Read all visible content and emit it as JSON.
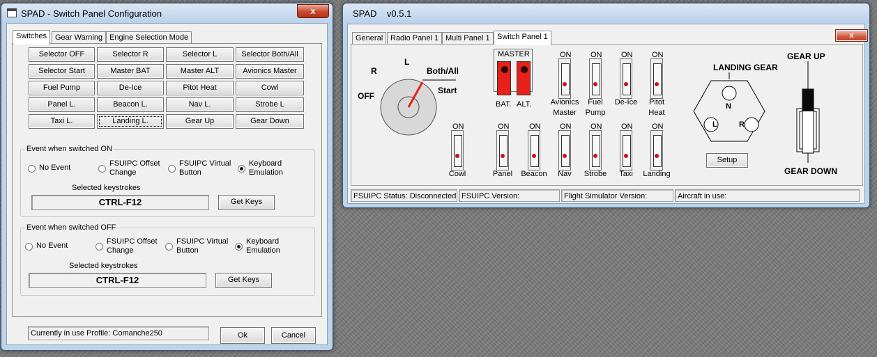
{
  "left_window": {
    "title": "SPAD - Switch Panel Configuration",
    "close_label": "x",
    "tabs": [
      {
        "label": "Switches",
        "active": true
      },
      {
        "label": "Gear Warning",
        "active": false
      },
      {
        "label": "Engine Selection Mode",
        "active": false
      }
    ],
    "switch_buttons": [
      "Selector OFF",
      "Selector R",
      "Selector L",
      "Selector Both/All",
      "Selector Start",
      "Master BAT",
      "Master ALT",
      "Avionics Master",
      "Fuel Pump",
      "De-Ice",
      "Pitot Heat",
      "Cowl",
      "Panel L.",
      "Beacon L.",
      "Nav L.",
      "Strobe L",
      "Taxi L.",
      "Landing L.",
      "Gear Up",
      "Gear Down"
    ],
    "selected_button": "Landing L.",
    "event_on": {
      "label": "Event when switched ON",
      "options": [
        {
          "label": "No Event",
          "checked": false
        },
        {
          "label": "FSUIPC Offset\nChange",
          "checked": false
        },
        {
          "label": "FSUIPC Virtual\nButton",
          "checked": false
        },
        {
          "label": "Keyboard\nEmulation",
          "checked": true
        }
      ],
      "keystrokes_label": "Selected keystrokes",
      "keystrokes_value": "CTRL-F12",
      "get_keys_label": "Get Keys"
    },
    "event_off": {
      "label": "Event when switched OFF",
      "options": [
        {
          "label": "No Event",
          "checked": false
        },
        {
          "label": "FSUIPC Offset\nChange",
          "checked": false
        },
        {
          "label": "FSUIPC Virtual\nButton",
          "checked": false
        },
        {
          "label": "Keyboard\nEmulation",
          "checked": true
        }
      ],
      "keystrokes_label": "Selected keystrokes",
      "keystrokes_value": "CTRL-F12",
      "get_keys_label": "Get Keys"
    },
    "profile_text": "Currently in use Profile:  Comanche250",
    "ok_label": "Ok",
    "cancel_label": "Cancel"
  },
  "right_window": {
    "title": "SPAD    v0.5.1",
    "close_label": "x",
    "tabs": [
      {
        "label": "General",
        "active": false
      },
      {
        "label": "Radio Panel 1",
        "active": false
      },
      {
        "label": "Multi Panel 1",
        "active": false
      },
      {
        "label": "Switch Panel 1",
        "active": true
      }
    ],
    "selector": {
      "off": "OFF",
      "r": "R",
      "l": "L",
      "both": "Both/All",
      "start": "Start"
    },
    "master": {
      "label": "MASTER",
      "bat": "BAT.",
      "alt": "ALT.",
      "color": "#e8201a"
    },
    "on_label": "ON",
    "top_switches": [
      {
        "label": "Avionics\nMaster"
      },
      {
        "label": "Fuel\nPump"
      },
      {
        "label": "De-Ice"
      },
      {
        "label": "Pitot\nHeat"
      }
    ],
    "bottom_switches": [
      {
        "label": "Cowl"
      },
      {
        "label": "Panel"
      },
      {
        "label": "Beacon"
      },
      {
        "label": "Nav"
      },
      {
        "label": "Strobe"
      },
      {
        "label": "Taxi"
      },
      {
        "label": "Landing"
      }
    ],
    "landing_gear": {
      "label": "LANDING GEAR",
      "n": "N",
      "l": "L",
      "r": "R",
      "setup_label": "Setup"
    },
    "gear_up": "GEAR UP",
    "gear_down": "GEAR DOWN",
    "status": {
      "fsuipc_status": "FSUIPC Status: Disconnected",
      "fsuipc_version": "FSUIPC Version:",
      "fs_version": "Flight Simulator Version:",
      "aircraft": "Aircraft in use:"
    }
  }
}
